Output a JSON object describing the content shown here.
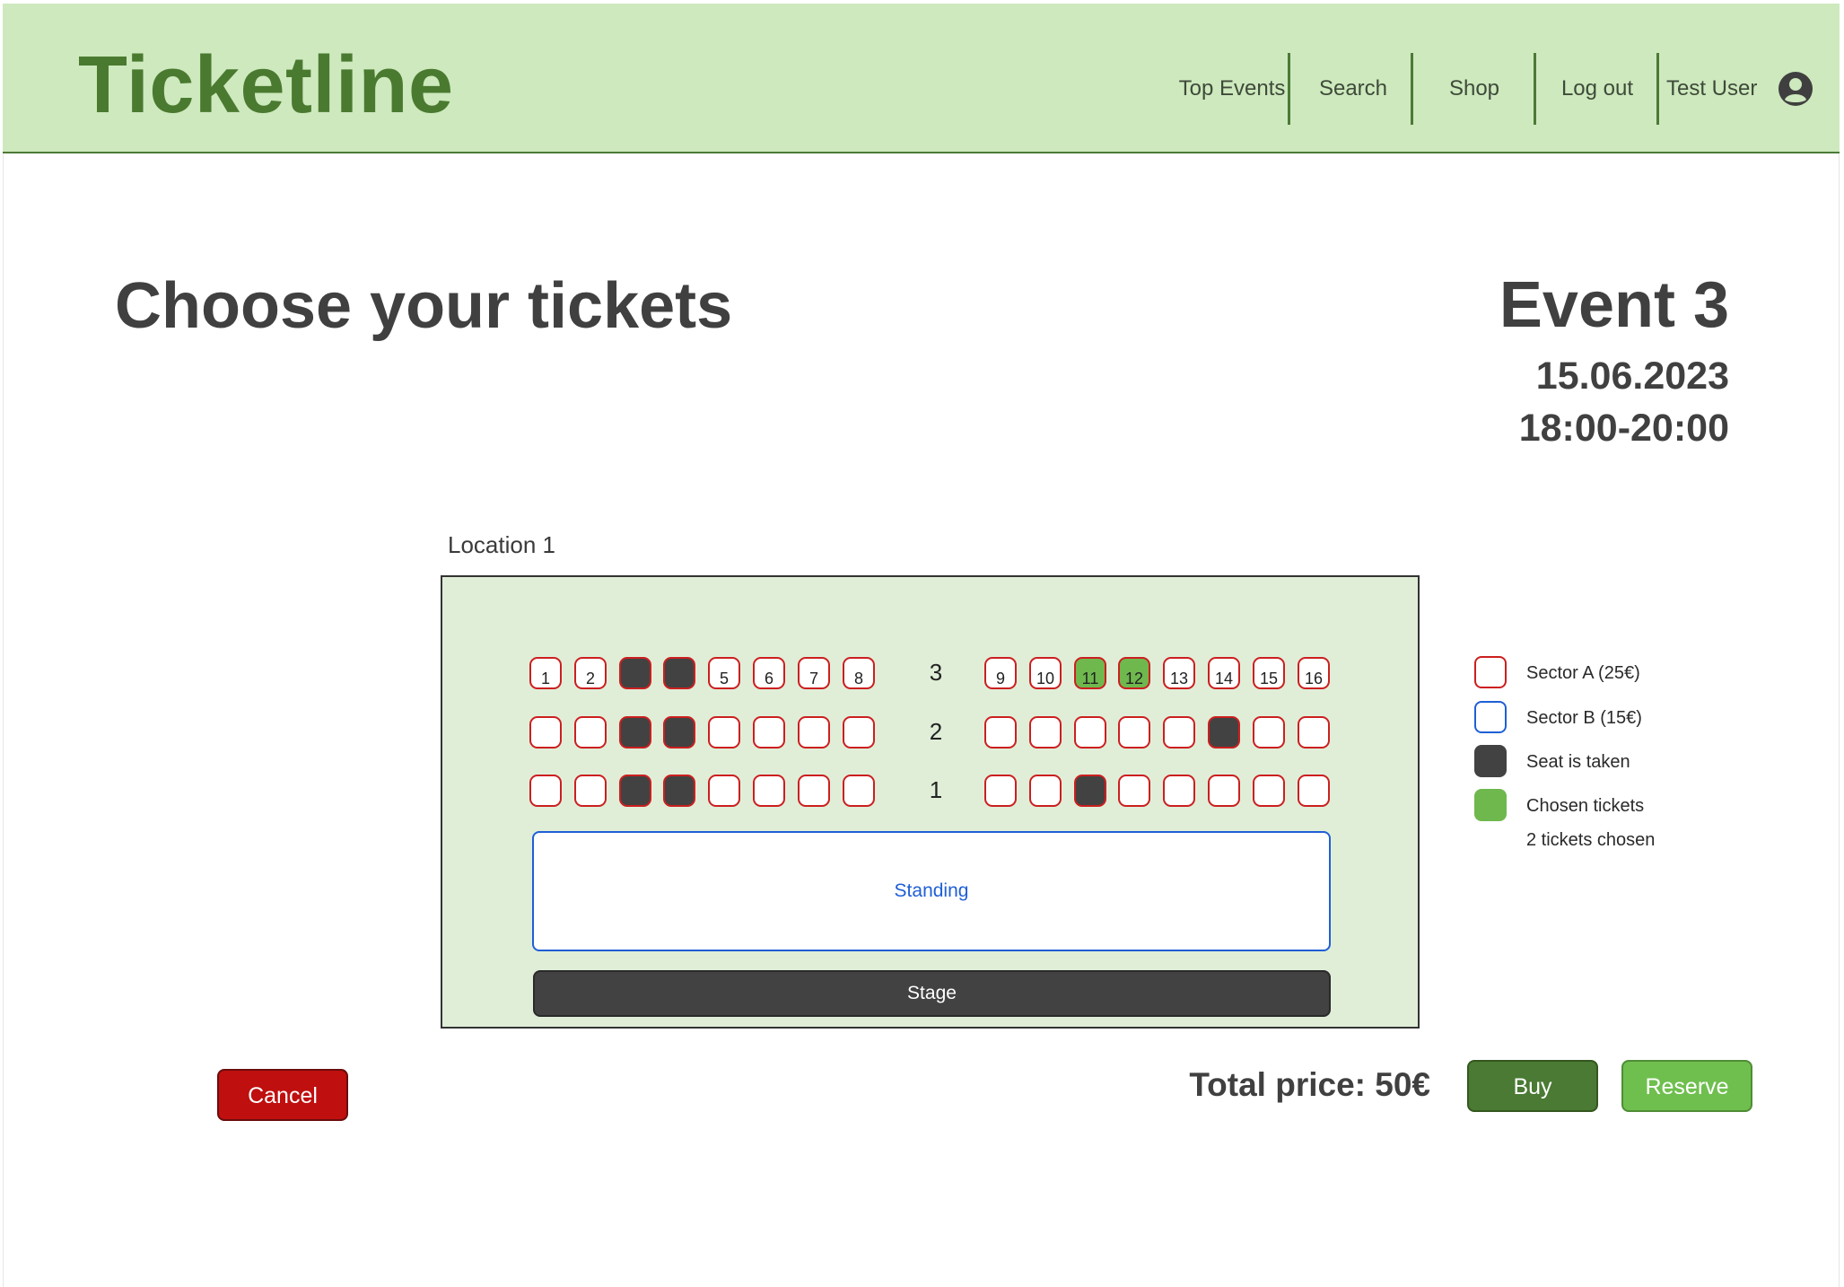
{
  "app": {
    "brand": "Ticketline"
  },
  "nav": {
    "items": [
      {
        "label": "Top Events"
      },
      {
        "label": "Search"
      },
      {
        "label": "Shop"
      },
      {
        "label": "Log out"
      },
      {
        "label": "Test User"
      }
    ],
    "user_icon": "account-circle-icon"
  },
  "page": {
    "title": "Choose your tickets"
  },
  "event": {
    "name": "Event 3",
    "date": "15.06.2023",
    "time": "18:00-20:00"
  },
  "location": {
    "label": "Location 1"
  },
  "seating": {
    "rows": [
      {
        "label": "3",
        "seats": [
          {
            "number": "1",
            "state": "free"
          },
          {
            "number": "2",
            "state": "free"
          },
          {
            "number": "",
            "state": "taken"
          },
          {
            "number": "",
            "state": "taken"
          },
          {
            "number": "5",
            "state": "free"
          },
          {
            "number": "6",
            "state": "free"
          },
          {
            "number": "7",
            "state": "free"
          },
          {
            "number": "8",
            "state": "free"
          },
          {
            "number": "9",
            "state": "free"
          },
          {
            "number": "10",
            "state": "free"
          },
          {
            "number": "11",
            "state": "chosen"
          },
          {
            "number": "12",
            "state": "chosen"
          },
          {
            "number": "13",
            "state": "free"
          },
          {
            "number": "14",
            "state": "free"
          },
          {
            "number": "15",
            "state": "free"
          },
          {
            "number": "16",
            "state": "free"
          }
        ]
      },
      {
        "label": "2",
        "seats": [
          {
            "number": "",
            "state": "free"
          },
          {
            "number": "",
            "state": "free"
          },
          {
            "number": "",
            "state": "taken"
          },
          {
            "number": "",
            "state": "taken"
          },
          {
            "number": "",
            "state": "free"
          },
          {
            "number": "",
            "state": "free"
          },
          {
            "number": "",
            "state": "free"
          },
          {
            "number": "",
            "state": "free"
          },
          {
            "number": "",
            "state": "free"
          },
          {
            "number": "",
            "state": "free"
          },
          {
            "number": "",
            "state": "free"
          },
          {
            "number": "",
            "state": "free"
          },
          {
            "number": "",
            "state": "free"
          },
          {
            "number": "",
            "state": "taken"
          },
          {
            "number": "",
            "state": "free"
          },
          {
            "number": "",
            "state": "free"
          }
        ]
      },
      {
        "label": "1",
        "seats": [
          {
            "number": "",
            "state": "free"
          },
          {
            "number": "",
            "state": "free"
          },
          {
            "number": "",
            "state": "taken"
          },
          {
            "number": "",
            "state": "taken"
          },
          {
            "number": "",
            "state": "free"
          },
          {
            "number": "",
            "state": "free"
          },
          {
            "number": "",
            "state": "free"
          },
          {
            "number": "",
            "state": "free"
          },
          {
            "number": "",
            "state": "free"
          },
          {
            "number": "",
            "state": "free"
          },
          {
            "number": "",
            "state": "taken"
          },
          {
            "number": "",
            "state": "free"
          },
          {
            "number": "",
            "state": "free"
          },
          {
            "number": "",
            "state": "free"
          },
          {
            "number": "",
            "state": "free"
          },
          {
            "number": "",
            "state": "free"
          }
        ]
      }
    ],
    "standing_label": "Standing",
    "stage_label": "Stage"
  },
  "legend": {
    "items": [
      {
        "label": "Sector A (25€)",
        "color": "#ffffff",
        "border": "#cc1f1f"
      },
      {
        "label": "Sector B (15€)",
        "color": "#ffffff",
        "border": "#1f5fd6"
      },
      {
        "label": "Seat is taken",
        "color": "#424242",
        "border": "#424242"
      },
      {
        "label": "Chosen tickets",
        "color": "#6eb84e",
        "border": "#6eb84e"
      }
    ],
    "note": "2 tickets chosen"
  },
  "summary": {
    "total_price": "Total price: 50€"
  },
  "actions": {
    "cancel_label": "Cancel",
    "buy_label": "Buy",
    "reserve_label": "Reserve"
  },
  "colors": {
    "header_bg": "#cde9bd",
    "brand": "#4a7a30",
    "venue_bg": "#e0eed8",
    "cancel": "#bf0f0f",
    "buy": "#4a7a33",
    "reserve": "#6fbf4f"
  }
}
